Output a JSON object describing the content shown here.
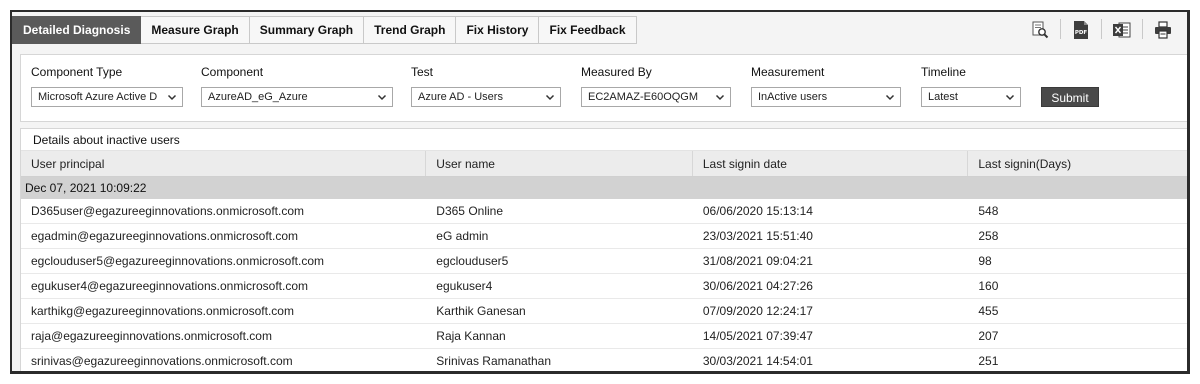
{
  "tabs": [
    {
      "label": "Detailed Diagnosis",
      "active": true
    },
    {
      "label": "Measure Graph",
      "active": false
    },
    {
      "label": "Summary Graph",
      "active": false
    },
    {
      "label": "Trend Graph",
      "active": false
    },
    {
      "label": "Fix History",
      "active": false
    },
    {
      "label": "Fix Feedback",
      "active": false
    }
  ],
  "toolbar": {
    "icons": [
      "search-report-icon",
      "pdf-icon",
      "excel-icon",
      "print-icon"
    ],
    "pdf_text": "PDF"
  },
  "filters": {
    "component_type": {
      "label": "Component Type",
      "value": "Microsoft Azure Active D"
    },
    "component": {
      "label": "Component",
      "value": "AzureAD_eG_Azure"
    },
    "test": {
      "label": "Test",
      "value": "Azure AD - Users"
    },
    "measured_by": {
      "label": "Measured By",
      "value": "EC2AMAZ-E60OQGM"
    },
    "measurement": {
      "label": "Measurement",
      "value": "InActive users"
    },
    "timeline": {
      "label": "Timeline",
      "value": "Latest"
    },
    "submit_label": "Submit"
  },
  "details": {
    "caption": "Details about inactive users",
    "columns": [
      "User principal",
      "User name",
      "Last signin date",
      "Last signin(Days)"
    ],
    "group_label": "Dec 07, 2021 10:09:22",
    "rows": [
      [
        "D365user@egazureeginnovations.onmicrosoft.com",
        "D365 Online",
        "06/06/2020 15:13:14",
        "548"
      ],
      [
        "egadmin@egazureeginnovations.onmicrosoft.com",
        "eG admin",
        "23/03/2021 15:51:40",
        "258"
      ],
      [
        "egclouduser5@egazureeginnovations.onmicrosoft.com",
        "egclouduser5",
        "31/08/2021 09:04:21",
        "98"
      ],
      [
        "egukuser4@egazureeginnovations.onmicrosoft.com",
        "egukuser4",
        "30/06/2021 04:27:26",
        "160"
      ],
      [
        "karthikg@egazureeginnovations.onmicrosoft.com",
        "Karthik Ganesan",
        "07/09/2020 12:24:17",
        "455"
      ],
      [
        "raja@egazureeginnovations.onmicrosoft.com",
        "Raja Kannan",
        "14/05/2021 07:39:47",
        "207"
      ],
      [
        "srinivas@egazureeginnovations.onmicrosoft.com",
        "Srinivas Ramanathan",
        "30/03/2021 14:54:01",
        "251"
      ]
    ]
  }
}
